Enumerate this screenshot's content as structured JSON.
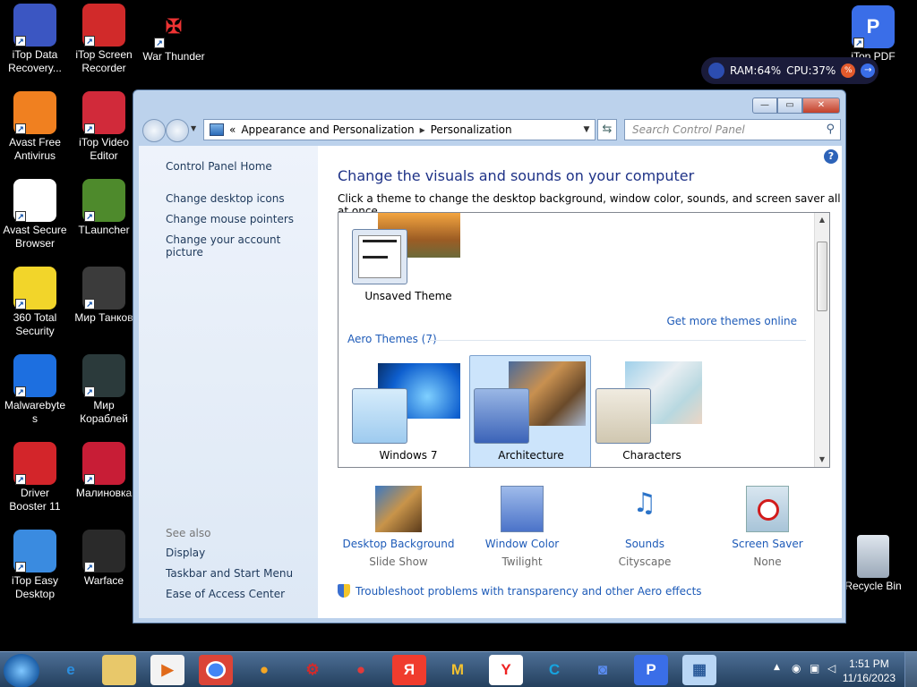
{
  "desktop": {
    "icons_left": [
      {
        "label": "iTop Data\nRecovery...",
        "color": "#3b56c2",
        "glyph": "iTop Data Recovery"
      },
      {
        "label": "Avast Free\nAntivirus",
        "color": "#f08020",
        "glyph": "Avast"
      },
      {
        "label": "Avast Secure\nBrowser",
        "color": "#ffffff",
        "glyph": "Avast Secure"
      },
      {
        "label": "360 Total\nSecurity",
        "color": "#f2d52a",
        "glyph": "360"
      },
      {
        "label": "Malwarebyte\ns",
        "color": "#1d6fe0",
        "glyph": "Malwarebytes"
      },
      {
        "label": "Driver\nBooster 11",
        "color": "#d3252a",
        "glyph": "Driver Booster"
      },
      {
        "label": "iTop Easy\nDesktop",
        "color": "#3a8be0",
        "glyph": "iTop Easy Desktop"
      }
    ],
    "icons_mid": [
      {
        "label": "iTop Screen\nRecorder",
        "color": "#d12a2a",
        "glyph": "iTop Screen Recorder"
      },
      {
        "label": "iTop Video\nEditor",
        "color": "#d12a3a",
        "glyph": "iTop Video Editor"
      },
      {
        "label": "TLauncher",
        "color": "#4e8a2c",
        "glyph": "TLauncher"
      },
      {
        "label": "Мир Танков",
        "color": "#3b3b3b",
        "glyph": "Мир Танков"
      },
      {
        "label": "Мир\nКораблей",
        "color": "#2b3a3b",
        "glyph": "Мир Кораблей"
      },
      {
        "label": "Малиновка",
        "color": "#c81d36",
        "glyph": "M"
      },
      {
        "label": "Warface",
        "color": "#2a2a2a",
        "glyph": "Warface"
      }
    ],
    "war_thunder": {
      "label": "War Thunder"
    },
    "itop_pdf": {
      "label": "iTop PDF",
      "glyph": "P"
    },
    "recycle_bin": {
      "label": "Recycle Bin"
    }
  },
  "widget": {
    "ram": "RAM:64%",
    "cpu": "CPU:37%"
  },
  "window": {
    "breadcrumb": [
      "Appearance and Personalization",
      "Personalization"
    ],
    "breadcrumb_prefix": "«",
    "search_placeholder": "Search Control Panel",
    "sidebar": {
      "home": "Control Panel Home",
      "links": [
        "Change desktop icons",
        "Change mouse pointers",
        "Change your account picture"
      ],
      "see_also": "See also",
      "see_links": [
        "Display",
        "Taskbar and Start Menu",
        "Ease of Access Center"
      ]
    },
    "main": {
      "title": "Change the visuals and sounds on your computer",
      "subtitle": "Click a theme to change the desktop background, window color, sounds, and screen saver all at once.",
      "unsaved": "Unsaved Theme",
      "get_more": "Get more themes online",
      "aero_header": "Aero Themes (7)",
      "themes": [
        "Windows 7",
        "Architecture",
        "Characters"
      ],
      "selected_theme": "Architecture",
      "bottom": [
        {
          "label": "Desktop Background",
          "sub": "Slide Show"
        },
        {
          "label": "Window Color",
          "sub": "Twilight"
        },
        {
          "label": "Sounds",
          "sub": "Cityscape"
        },
        {
          "label": "Screen Saver",
          "sub": "None"
        }
      ],
      "troubleshoot": "Troubleshoot problems with transparency and other Aero effects"
    }
  },
  "taskbar": {
    "time": "1:51 PM",
    "date": "11/16/2023"
  }
}
